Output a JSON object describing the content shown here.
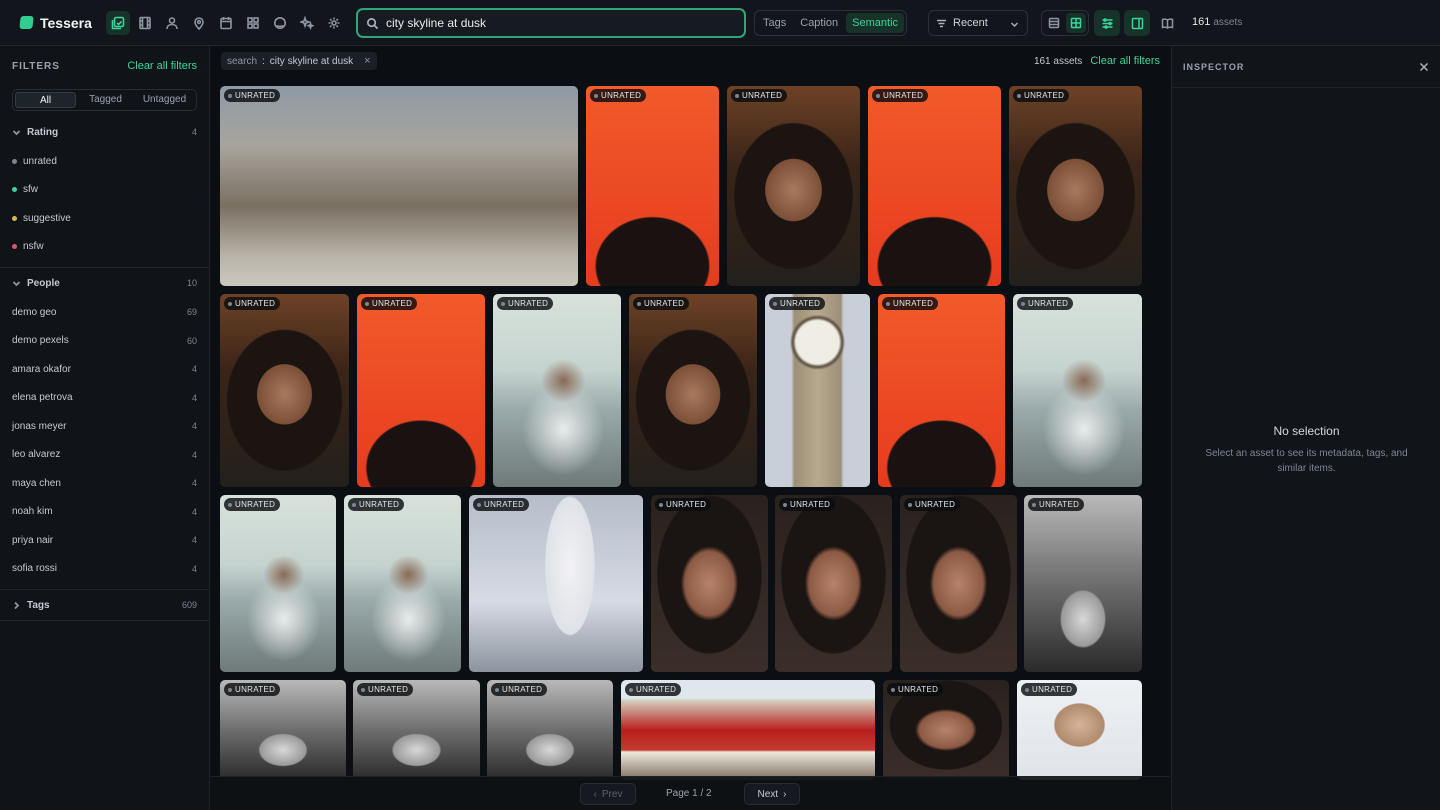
{
  "app": {
    "name": "Tessera"
  },
  "nav": [
    "library-icon",
    "film-icon",
    "person-icon",
    "location-pin-icon",
    "calendar-icon",
    "grid-icon",
    "face-icon",
    "sparkles-icon",
    "gear-icon"
  ],
  "search": {
    "value": "city skyline at dusk",
    "placeholder": "Search"
  },
  "modes": {
    "tags": "Tags",
    "caption": "Caption",
    "semantic": "Semantic",
    "active": "Semantic"
  },
  "sort": {
    "selected": "Recent"
  },
  "topbar": {
    "asset_count": "161",
    "asset_label": "assets"
  },
  "filters": {
    "title": "FILTERS",
    "clear": "Clear all filters",
    "segments": [
      "All",
      "Tagged",
      "Untagged"
    ],
    "rating": {
      "title": "Rating",
      "count": "4",
      "items": [
        {
          "label": "unrated",
          "color": "#7d8591"
        },
        {
          "label": "sfw",
          "color": "#3ad59a"
        },
        {
          "label": "suggestive",
          "color": "#e0b84a"
        },
        {
          "label": "nsfw",
          "color": "#e0566a"
        }
      ]
    },
    "people": {
      "title": "People",
      "count": "10",
      "items": [
        {
          "label": "demo geo",
          "count": "69"
        },
        {
          "label": "demo pexels",
          "count": "60"
        },
        {
          "label": "amara okafor",
          "count": "4"
        },
        {
          "label": "elena petrova",
          "count": "4"
        },
        {
          "label": "jonas meyer",
          "count": "4"
        },
        {
          "label": "leo alvarez",
          "count": "4"
        },
        {
          "label": "maya chen",
          "count": "4"
        },
        {
          "label": "noah kim",
          "count": "4"
        },
        {
          "label": "priya nair",
          "count": "4"
        },
        {
          "label": "sofia rossi",
          "count": "4"
        }
      ]
    },
    "tags": {
      "title": "Tags",
      "count": "609"
    }
  },
  "chipbar": {
    "chip_key": "search",
    "chip_value": "city skyline at dusk",
    "count_text": "161 assets",
    "clear": "Clear all filters"
  },
  "badge_label": "UNRATED",
  "pager": {
    "prev": "Prev",
    "next": "Next",
    "info": "Page 1 / 2"
  },
  "inspector": {
    "title": "INSPECTOR",
    "empty_title": "No selection",
    "empty_desc": "Select an asset to see its metadata, tags, and similar items."
  },
  "thumbnails": [
    "construction",
    "red-curly",
    "woman-flowers",
    "red-curly",
    "woman-flowers",
    "woman-flowers",
    "red-curly",
    "man-sea",
    "woman-flowers",
    "clocktower",
    "red-curly",
    "man-sea",
    "man-sea",
    "man-sea",
    "statue",
    "woman-dark",
    "woman-dark",
    "woman-dark",
    "bald-bw",
    "bald-bw",
    "bald-bw",
    "bald-bw",
    "bus",
    "woman-dark",
    "man-glasses"
  ]
}
